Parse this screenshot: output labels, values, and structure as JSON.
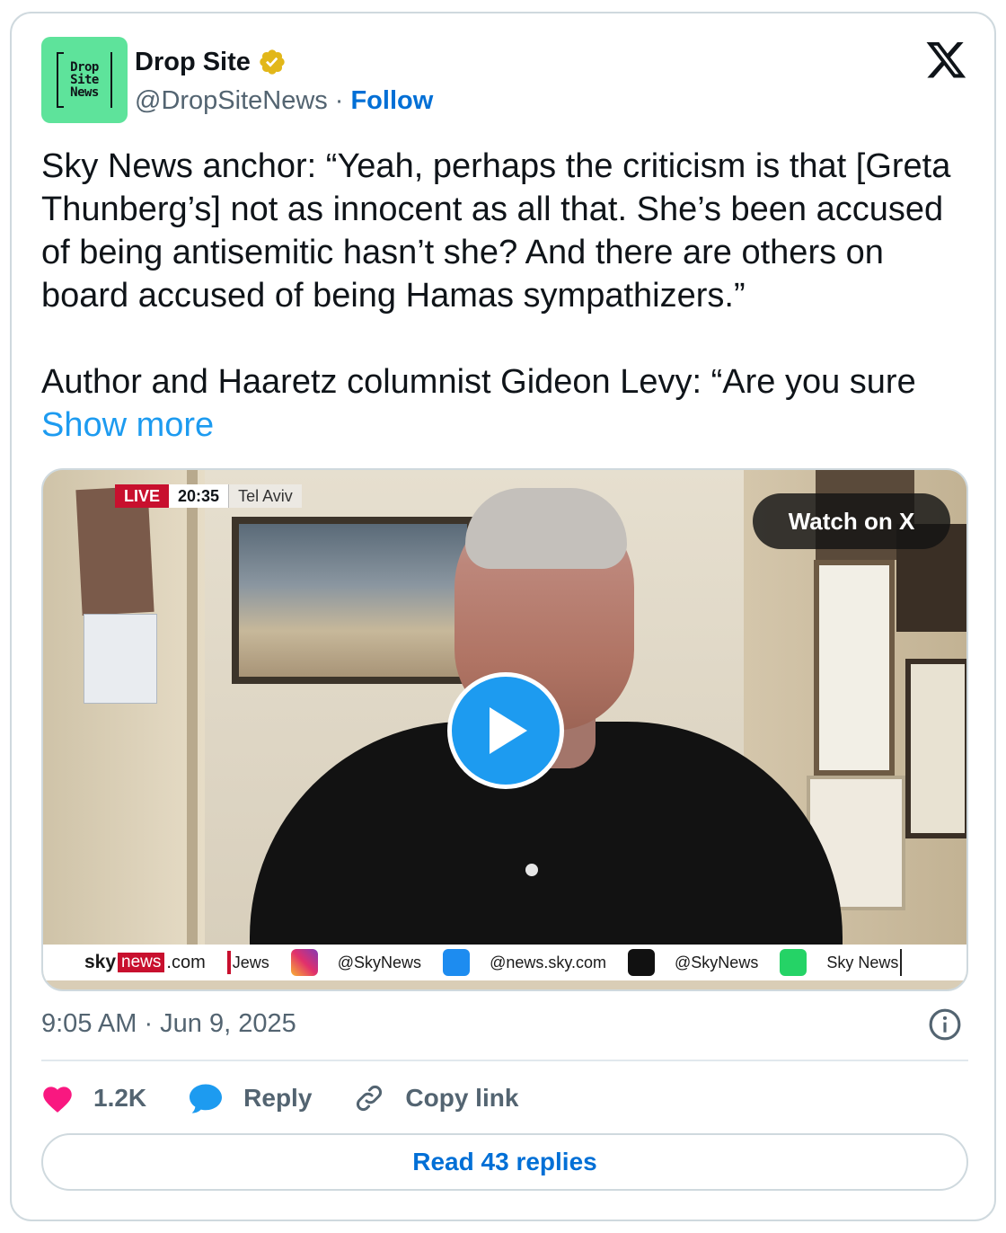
{
  "author": {
    "avatar_lines": [
      "Drop",
      "Site",
      "News"
    ],
    "name": "Drop Site",
    "handle": "@DropSiteNews",
    "separator": "·",
    "follow_label": "Follow"
  },
  "tweet": {
    "paragraph1": "Sky News anchor: “Yeah, perhaps the criticism is that [Greta Thunberg’s] not as innocent as all that. She’s been accused of being antisemitic hasn’t she? And there are others on board accused of being Hamas sympathizers.”",
    "paragraph2": "Author and Haaretz columnist Gideon Levy: “Are you sure",
    "show_more": "Show more"
  },
  "media": {
    "live_label": "LIVE",
    "live_time": "20:35",
    "live_place": "Tel Aviv",
    "watch_label": "Watch on X",
    "ticker": {
      "sky": "sky",
      "news": "news",
      "dotcom": ".com",
      "news_partial": "Jews",
      "instagram": "@SkyNews",
      "bluesky": "@news.sky.com",
      "tiktok": "@SkyNews",
      "whatsapp": "Sky News"
    }
  },
  "meta": {
    "timestamp": "9:05 AM · Jun 9, 2025"
  },
  "actions": {
    "likes": "1.2K",
    "reply_label": "Reply",
    "copy_label": "Copy link"
  },
  "read_replies_label": "Read 43 replies",
  "colors": {
    "avatar_bg": "#5ee39b",
    "link_blue": "#006fd6",
    "show_more_blue": "#1d9bf0",
    "heart": "#f91880",
    "reply_bubble": "#1d9bf0",
    "verified_gold": "#e2b719",
    "live_red": "#c8102e"
  },
  "icons": [
    "verified-badge-icon",
    "x-logo-icon",
    "play-icon",
    "info-icon",
    "heart-icon",
    "reply-bubble-icon",
    "link-icon",
    "instagram-icon",
    "bluesky-icon",
    "tiktok-icon",
    "whatsapp-icon"
  ]
}
